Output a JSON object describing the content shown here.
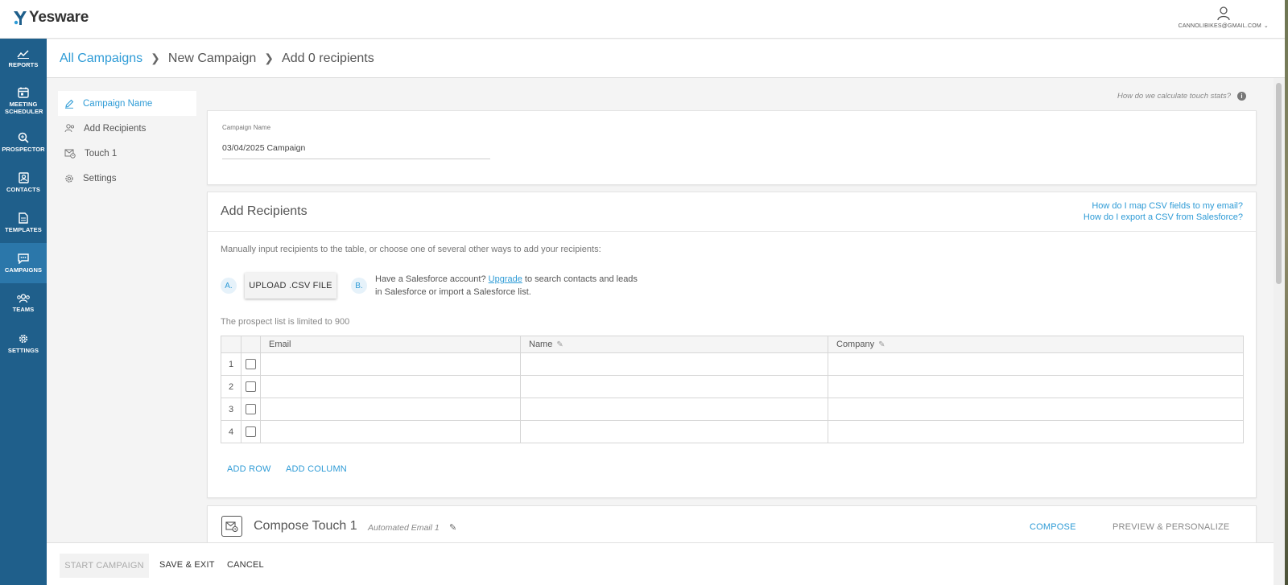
{
  "app": {
    "logo_text": "Yesware",
    "user_email": "CANNOLIBIKES@GMAIL.COM",
    "colors": {
      "sidebar": "#1f5f8b",
      "sidebar_active": "#2b77aa",
      "accent": "#2e9bd6"
    }
  },
  "sidebar": {
    "items": [
      {
        "label": "REPORTS",
        "icon": "chart-icon"
      },
      {
        "label": "MEETING SCHEDULER",
        "icon": "calendar-icon"
      },
      {
        "label": "PROSPECTOR",
        "icon": "search-icon"
      },
      {
        "label": "CONTACTS",
        "icon": "contact-card-icon"
      },
      {
        "label": "TEMPLATES",
        "icon": "document-icon"
      },
      {
        "label": "CAMPAIGNS",
        "icon": "chat-icon",
        "active": true
      },
      {
        "label": "TEAMS",
        "icon": "people-icon"
      },
      {
        "label": "SETTINGS",
        "icon": "gear-icon"
      }
    ]
  },
  "breadcrumb": {
    "root": "All Campaigns",
    "middle": "New Campaign",
    "current": "Add 0 recipients"
  },
  "steps": [
    {
      "label": "Campaign Name",
      "icon": "pencil-icon",
      "active": true
    },
    {
      "label": "Add Recipients",
      "icon": "people-icon"
    },
    {
      "label": "Touch 1",
      "icon": "mail-clock-icon"
    },
    {
      "label": "Settings",
      "icon": "gear-icon"
    }
  ],
  "touch_stats_link": "How do we calculate touch stats?",
  "campaign_name": {
    "label": "Campaign Name",
    "value": "03/04/2025 Campaign"
  },
  "add_recipients": {
    "title": "Add Recipients",
    "help_links": [
      "How do I map CSV fields to my email?",
      "How do I export a CSV from Salesforce?"
    ],
    "intro": "Manually input recipients to the table, or choose one of several other ways to add your recipients:",
    "option_a": "A.",
    "option_b": "B.",
    "upload_button": "UPLOAD .CSV FILE",
    "salesforce_pre": "Have a Salesforce account? ",
    "salesforce_link": "Upgrade",
    "salesforce_post": " to search contacts and leads in Salesforce or import a Salesforce list.",
    "limit_text": "The prospect list is limited to 900",
    "columns": [
      "Email",
      "Name",
      "Company"
    ],
    "rows": [
      "1",
      "2",
      "3",
      "4"
    ],
    "add_row": "ADD ROW",
    "add_column": "ADD COLUMN"
  },
  "compose": {
    "title": "Compose Touch 1",
    "subtitle": "Automated Email 1",
    "compose_tab": "COMPOSE",
    "preview_tab": "PREVIEW & PERSONALIZE"
  },
  "footer": {
    "start": "START CAMPAIGN",
    "save_exit": "SAVE & EXIT",
    "cancel": "CANCEL"
  }
}
